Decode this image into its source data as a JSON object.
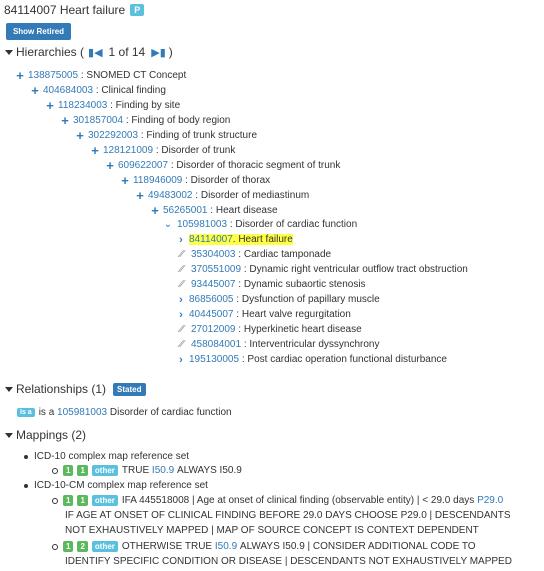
{
  "concept": {
    "code": "84114007",
    "name": "Heart failure",
    "badge": "P"
  },
  "retired_button": "Show Retired",
  "hierarchies": {
    "label": "Hierarchies (",
    "page_text": "1 of 14",
    "close": ")",
    "first_icon": "first-page-icon",
    "next_icon": "next-page-icon",
    "ancestors": [
      {
        "code": "138875005",
        "name": "SNOMED CT Concept"
      },
      {
        "code": "404684003",
        "name": "Clinical finding"
      },
      {
        "code": "118234003",
        "name": "Finding by site"
      },
      {
        "code": "301857004",
        "name": "Finding of body region"
      },
      {
        "code": "302292003",
        "name": "Finding of trunk structure"
      },
      {
        "code": "128121009",
        "name": "Disorder of trunk"
      },
      {
        "code": "609622007",
        "name": "Disorder of thoracic segment of trunk"
      },
      {
        "code": "118946009",
        "name": "Disorder of thorax"
      },
      {
        "code": "49483002",
        "name": "Disorder of mediastinum"
      },
      {
        "code": "56265001",
        "name": "Heart disease"
      }
    ],
    "parent": {
      "code": "105981003",
      "name": "Disorder of cardiac function"
    },
    "children": [
      {
        "code": "84114007",
        "name": "Heart failure",
        "icon": "chevron-right-icon",
        "current": true
      },
      {
        "code": "35304003",
        "name": "Cardiac tamponade",
        "icon": "leaf-icon"
      },
      {
        "code": "370551009",
        "name": "Dynamic right ventricular outflow tract obstruction",
        "icon": "leaf-icon"
      },
      {
        "code": "93445007",
        "name": "Dynamic subaortic stenosis",
        "icon": "leaf-icon"
      },
      {
        "code": "86856005",
        "name": "Dysfunction of papillary muscle",
        "icon": "chevron-right-icon"
      },
      {
        "code": "40445007",
        "name": "Heart valve regurgitation",
        "icon": "chevron-right-icon"
      },
      {
        "code": "27012009",
        "name": "Hyperkinetic heart disease",
        "icon": "leaf-icon"
      },
      {
        "code": "458084001",
        "name": "Interventricular dyssynchrony",
        "icon": "leaf-icon"
      },
      {
        "code": "195130005",
        "name": "Post cardiac operation functional disturbance",
        "icon": "chevron-right-icon"
      }
    ]
  },
  "relationships": {
    "label": "Relationships (1)",
    "stated": "Stated",
    "isa_badge": "Is a",
    "isa_text": "is a",
    "target_code": "105981003",
    "target_name": "Disorder of cardiac function"
  },
  "mappings": {
    "label": "Mappings (2)",
    "sets": [
      {
        "name": "ICD-10 complex map reference set",
        "entries": [
          {
            "b1": "1",
            "b2": "1",
            "type": "other",
            "pre": "TRUE",
            "code": "I50.9",
            "post": "ALWAYS I50.9"
          }
        ]
      },
      {
        "name": "ICD-10-CM complex map reference set",
        "entries": [
          {
            "b1": "1",
            "b2": "1",
            "type": "other",
            "line1": "IFA 445518008 | Age at onset of clinical finding (observable entity) | < 29.0 days",
            "line1_code": "P29.0",
            "line2": "IF AGE AT ONSET OF CLINICAL FINDING BEFORE 29.0 DAYS CHOOSE P29.0 | DESCENDANTS",
            "line3": "NOT EXHAUSTIVELY MAPPED | MAP OF SOURCE CONCEPT IS CONTEXT DEPENDENT"
          },
          {
            "b1": "1",
            "b2": "2",
            "type": "other",
            "pre": "OTHERWISE TRUE",
            "code": "I50.9",
            "post": "ALWAYS I50.9 | CONSIDER ADDITIONAL CODE TO",
            "line2": "IDENTIFY SPECIFIC CONDITION OR DISEASE | DESCENDANTS NOT EXHAUSTIVELY MAPPED"
          }
        ]
      }
    ]
  }
}
